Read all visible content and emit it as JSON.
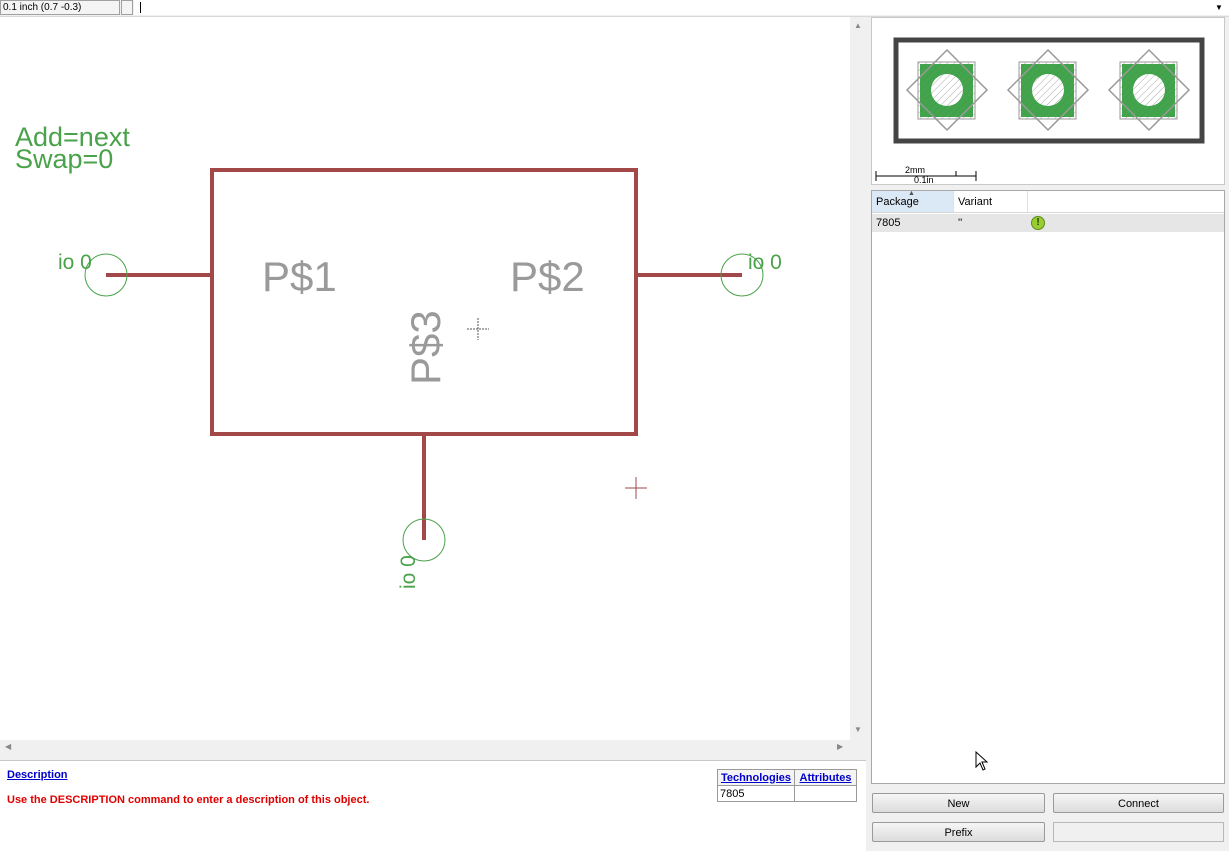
{
  "toolbar": {
    "grid_coordinates": "0.1 inch (0.7 -0.3)",
    "command_value": ""
  },
  "schematic": {
    "annotation_line1": "Add=next",
    "annotation_line2": "Swap=0",
    "pin_labels": [
      "P$1",
      "P$2",
      "P$3"
    ],
    "pin_io_label": "io 0",
    "colors": {
      "symbol_outline": "#a24848",
      "pin_text": "#9a9a9a",
      "annotation_text": "#4aa24a",
      "origin_cross": "#a24848"
    }
  },
  "description": {
    "link_label": "Description",
    "hint_text": "Use the DESCRIPTION command to enter a description of this object.",
    "table_headers": [
      "Technologies",
      "Attributes"
    ],
    "table_rows": [
      [
        "7805",
        ""
      ]
    ]
  },
  "preview": {
    "scale_mm": "2mm",
    "scale_in": "0.1in",
    "pad_color": "#2f9a3a"
  },
  "package_list": {
    "columns": [
      "Package",
      "Variant"
    ],
    "rows": [
      {
        "package": "7805",
        "variant": "''",
        "status_icon": "warning-icon"
      }
    ]
  },
  "buttons": {
    "new_label": "New",
    "connect_label": "Connect",
    "prefix_label": "Prefix",
    "prefix_value": ""
  }
}
